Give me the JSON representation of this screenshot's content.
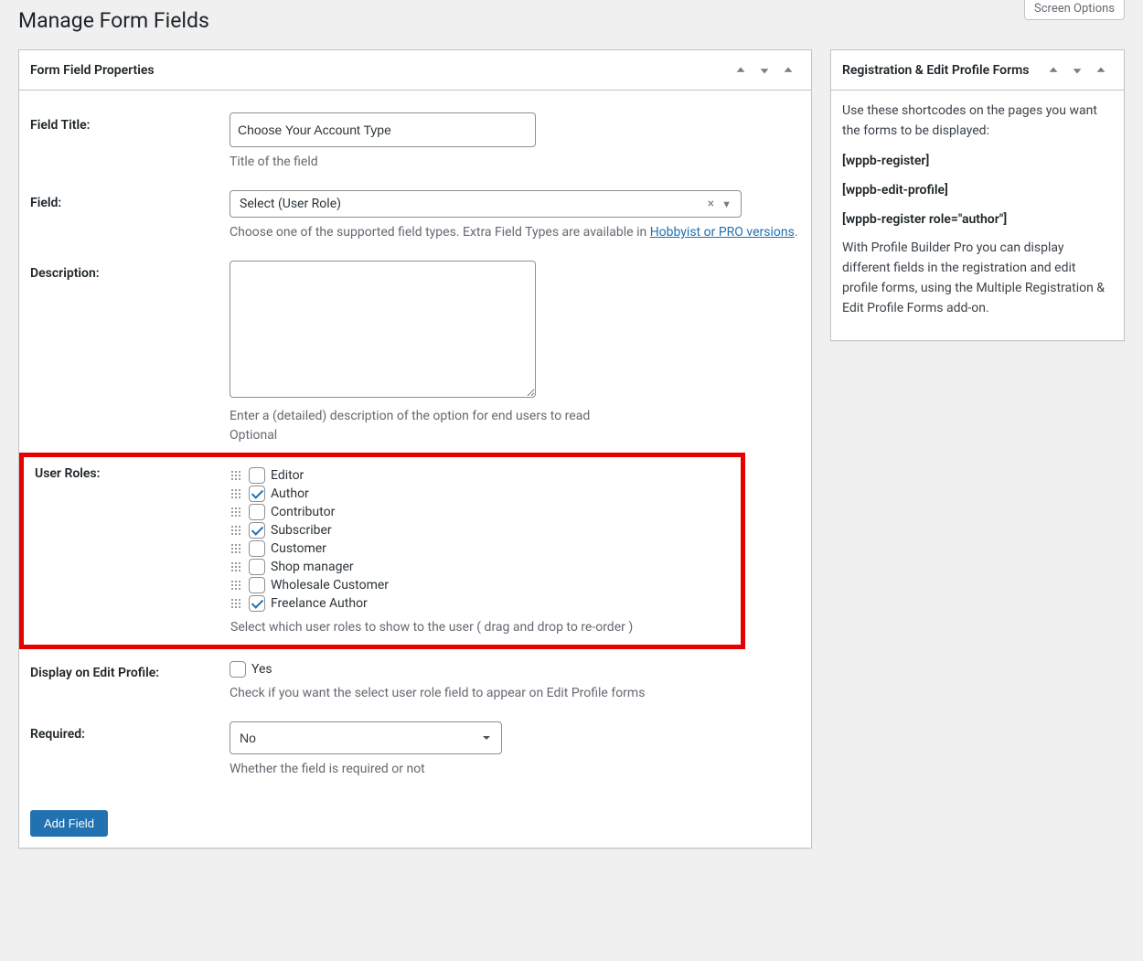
{
  "screen_options_label": "Screen Options",
  "page_title": "Manage Form Fields",
  "main_panel": {
    "title": "Form Field Properties",
    "field_title": {
      "label": "Field Title:",
      "value": "Choose Your Account Type",
      "help": "Title of the field"
    },
    "field_type": {
      "label": "Field:",
      "value": "Select (User Role)",
      "help_prefix": "Choose one of the supported field types. Extra Field Types are available in ",
      "help_link_text": "Hobbyist or PRO versions",
      "help_suffix": "."
    },
    "description": {
      "label": "Description:",
      "value": "",
      "help_line1": "Enter a (detailed) description of the option for end users to read",
      "help_line2": "Optional"
    },
    "user_roles": {
      "label": "User Roles:",
      "items": [
        {
          "name": "Editor",
          "checked": false
        },
        {
          "name": "Author",
          "checked": true
        },
        {
          "name": "Contributor",
          "checked": false
        },
        {
          "name": "Subscriber",
          "checked": true
        },
        {
          "name": "Customer",
          "checked": false
        },
        {
          "name": "Shop manager",
          "checked": false
        },
        {
          "name": "Wholesale Customer",
          "checked": false
        },
        {
          "name": "Freelance Author",
          "checked": true
        }
      ],
      "help": "Select which user roles to show to the user ( drag and drop to re-order )"
    },
    "display_edit_profile": {
      "label": "Display on Edit Profile:",
      "option": "Yes",
      "checked": false,
      "help": "Check if you want the select user role field to appear on Edit Profile forms"
    },
    "required": {
      "label": "Required:",
      "value": "No",
      "help": "Whether the field is required or not"
    },
    "submit_label": "Add Field"
  },
  "side_panel": {
    "title": "Registration & Edit Profile Forms",
    "intro": "Use these shortcodes on the pages you want the forms to be displayed:",
    "shortcodes": [
      "[wppb-register]",
      "[wppb-edit-profile]",
      "[wppb-register role=\"author\"]"
    ],
    "outro": "With Profile Builder Pro you can display different fields in the registration and edit profile forms, using the Multiple Registration & Edit Profile Forms add-on."
  }
}
